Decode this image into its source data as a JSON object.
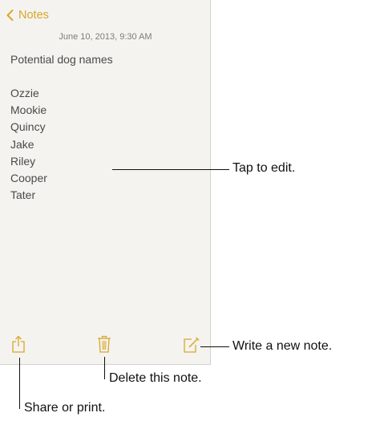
{
  "nav": {
    "back_label": "Notes"
  },
  "note": {
    "date": "June 10, 2013, 9:30 AM",
    "title": "Potential dog names",
    "lines": [
      "Ozzie",
      "Mookie",
      "Quincy",
      "Jake",
      "Riley",
      "Cooper",
      "Tater"
    ]
  },
  "toolbar": {
    "share_icon": "share-icon",
    "trash_icon": "trash-icon",
    "compose_icon": "compose-icon"
  },
  "callouts": {
    "tap_to_edit": "Tap to edit.",
    "write_new_note": "Write a new note.",
    "delete_note": "Delete this note.",
    "share_or_print": "Share or print."
  },
  "colors": {
    "accent": "#d9a72b",
    "paper": "#f4f3ef",
    "text": "#4a4a4a"
  }
}
